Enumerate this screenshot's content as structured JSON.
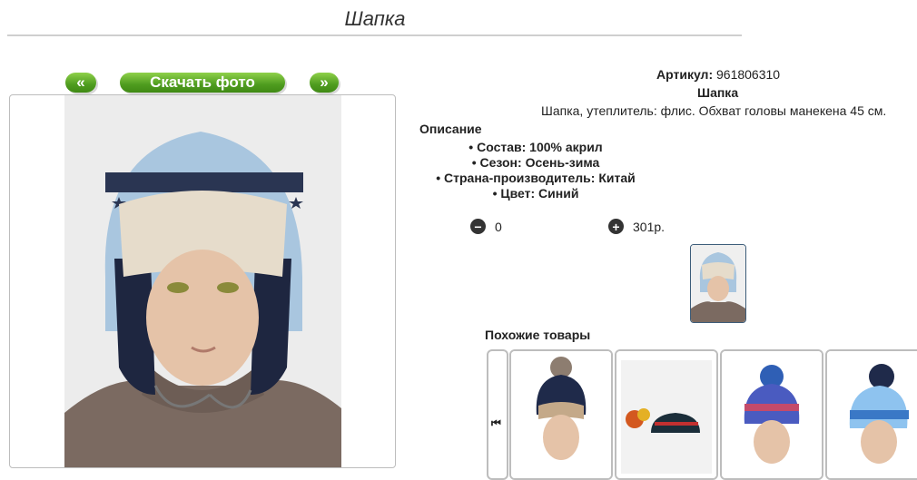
{
  "page": {
    "title": "Шапка"
  },
  "nav": {
    "prev_label": "«",
    "next_label": "»",
    "download_label": "Скачать фото"
  },
  "product": {
    "article_label": "Артикул:",
    "article_value": "961806310",
    "name": "Шапка",
    "short_desc": "Шапка, утеплитель: флис. Обхват головы манекена 45 см.",
    "description_title": "Описание",
    "properties": [
      "Состав: 100% акрил",
      "Сезон: Осень-зима",
      "Страна-производитель: Китай",
      "Цвет: Синий"
    ]
  },
  "cart": {
    "minus_icon": "minus-circle-icon",
    "plus_icon": "plus-circle-icon",
    "quantity": "0",
    "price": "301р."
  },
  "similar": {
    "title": "Похожие товары",
    "nav_icon": "skip-back-icon"
  },
  "colors": {
    "accent_green": "#4f9c1f",
    "thumb_border": "#3d5d7a"
  }
}
